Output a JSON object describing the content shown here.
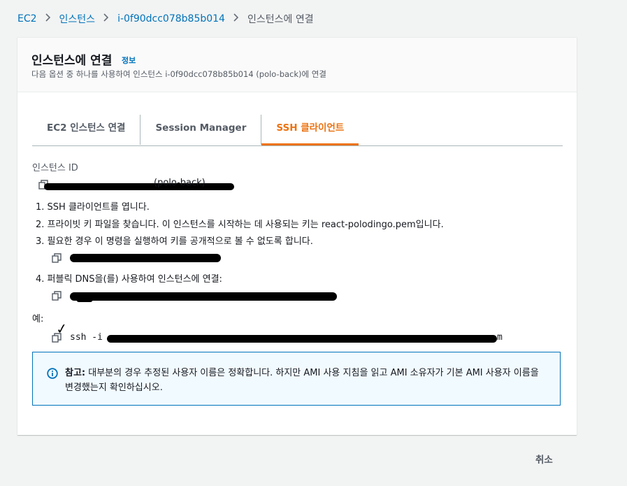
{
  "breadcrumb": {
    "items": [
      "EC2",
      "인스턴스",
      "i-0f90dcc078b85b014"
    ],
    "current": "인스턴스에 연결"
  },
  "header": {
    "title": "인스턴스에 연결",
    "info_link": "정보",
    "description": "다음 옵션 중 하나를 사용하여 인스턴스 i-0f90dcc078b85b014 (polo-back)에 연결"
  },
  "tabs": [
    {
      "label": "EC2 인스턴스 연결",
      "active": false
    },
    {
      "label": "Session Manager",
      "active": false
    },
    {
      "label": "SSH 클라이언트",
      "active": true
    }
  ],
  "instance": {
    "label": "인스턴스 ID",
    "value_suffix": "(polo-back)"
  },
  "steps": [
    "1. SSH 클라이언트를 엽니다.",
    "2. 프라이빗 키 파일을 찾습니다. 이 인스턴스를 시작하는 데 사용되는 키는 react-polodingo.pem입니다.",
    "3. 필요한 경우 이 명령을 실행하여 키를 공개적으로 볼 수 없도록 합니다.",
    "4. 퍼블릭 DNS을(를) 사용하여 인스턴스에 연결:"
  ],
  "example": {
    "label": "예:",
    "command_prefix": "ssh -i",
    "command_suffix": "m"
  },
  "alert": {
    "bold": "참고:",
    "text": " 대부분의 경우 추정된 사용자 이름은 정확합니다. 하지만 AMI 사용 지침을 읽고 AMI 소유자가 기본 AMI 사용자 이름을 변경했는지 확인하십시오."
  },
  "footer": {
    "cancel_label": "취소"
  },
  "colors": {
    "accent": "#ec7211",
    "link": "#0073bb",
    "info_bg": "#f1faff"
  },
  "icons": [
    "chevron-right-icon",
    "copy-icon",
    "info-icon",
    "checkmark-icon"
  ]
}
